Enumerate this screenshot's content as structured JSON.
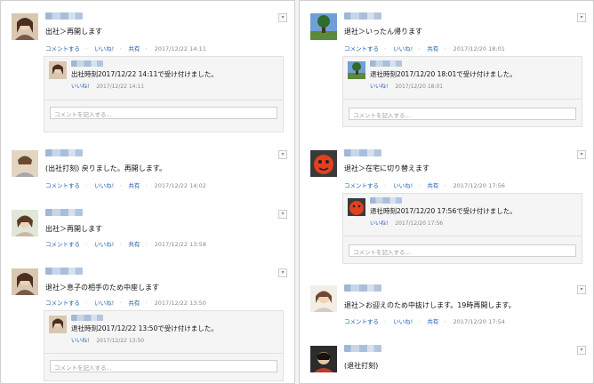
{
  "labels": {
    "comment": "コメントする",
    "like": "いいね!",
    "share": "共有",
    "comment_placeholder": "コメントを記入する...",
    "expand_icon": "▾"
  },
  "left": [
    {
      "message": "出社＞再開します",
      "timestamp": "2017/12/22 14:11",
      "reply": {
        "message": "出社時刻2017/12/22 14:11で受け付けました。",
        "timestamp": "2017/12/22 14:11"
      }
    },
    {
      "message": "(出社打刻) 戻りました。再開します。",
      "timestamp": "2017/12/22 14:02"
    },
    {
      "message": "出社＞再開します",
      "timestamp": "2017/12/22 13:58"
    },
    {
      "message": "退社＞息子の相手のため中座します",
      "timestamp": "2017/12/22 13:50",
      "reply": {
        "message": "退社時刻2017/12/22 13:50で受け付けました。",
        "timestamp": "2017/12/22 13:50"
      }
    }
  ],
  "right": [
    {
      "message": "退社＞いったん帰ります",
      "timestamp": "2017/12/20 18:01",
      "reply": {
        "message": "退社時刻2017/12/20 18:01で受け付けました。",
        "timestamp": "2017/12/20 18:01"
      }
    },
    {
      "message": "退社＞在宅に切り替えます",
      "timestamp": "2017/12/20 17:56",
      "reply": {
        "message": "退社時刻2017/12/20 17:56で受け付けました。",
        "timestamp": "2017/12/20 17:56"
      }
    },
    {
      "message": "退社＞お迎えのため中抜けします。19時再開します。",
      "timestamp": "2017/12/20 17:54"
    },
    {
      "message": "(退社打刻)"
    }
  ]
}
